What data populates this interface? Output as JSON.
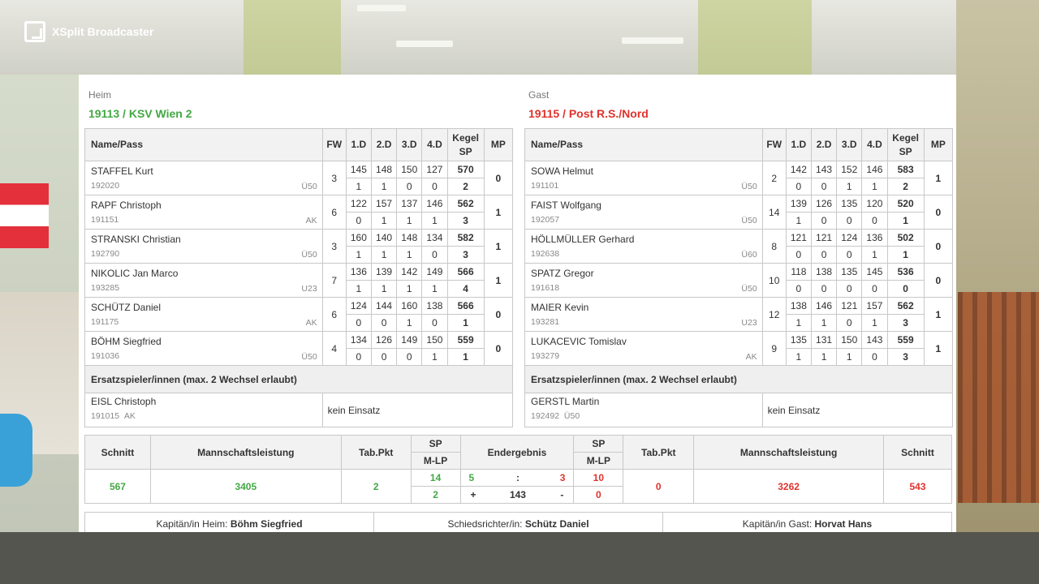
{
  "app": {
    "name": "XSplit Broadcaster"
  },
  "colors": {
    "home": "#44a844",
    "away": "#e0322c"
  },
  "headers": {
    "name": "Name/Pass",
    "fw": "FW",
    "d1": "1.D",
    "d2": "2.D",
    "d3": "3.D",
    "d4": "4.D",
    "kegel": "Kegel SP",
    "mp": "MP"
  },
  "home": {
    "role": "Heim",
    "team": "19113 / KSV Wien 2",
    "players": [
      {
        "name": "STAFFEL Kurt",
        "pass": "192020",
        "cls": "Ü50",
        "fw": "3",
        "d": [
          "145",
          "148",
          "150",
          "127"
        ],
        "dsp": [
          "1",
          "1",
          "0",
          "0"
        ],
        "kegel": "570",
        "sp": "2",
        "mp": "0"
      },
      {
        "name": "RAPF Christoph",
        "pass": "191151",
        "cls": "AK",
        "fw": "6",
        "d": [
          "122",
          "157",
          "137",
          "146"
        ],
        "dsp": [
          "0",
          "1",
          "1",
          "1"
        ],
        "kegel": "562",
        "sp": "3",
        "mp": "1"
      },
      {
        "name": "STRANSKI Christian",
        "pass": "192790",
        "cls": "Ü50",
        "fw": "3",
        "d": [
          "160",
          "140",
          "148",
          "134"
        ],
        "dsp": [
          "1",
          "1",
          "1",
          "0"
        ],
        "kegel": "582",
        "sp": "3",
        "mp": "1"
      },
      {
        "name": "NIKOLIC Jan Marco",
        "pass": "193285",
        "cls": "U23",
        "fw": "7",
        "d": [
          "136",
          "139",
          "142",
          "149"
        ],
        "dsp": [
          "1",
          "1",
          "1",
          "1"
        ],
        "kegel": "566",
        "sp": "4",
        "mp": "1"
      },
      {
        "name": "SCHÜTZ Daniel",
        "pass": "191175",
        "cls": "AK",
        "fw": "6",
        "d": [
          "124",
          "144",
          "160",
          "138"
        ],
        "dsp": [
          "0",
          "0",
          "1",
          "0"
        ],
        "kegel": "566",
        "sp": "1",
        "mp": "0"
      },
      {
        "name": "BÖHM Siegfried",
        "pass": "191036",
        "cls": "Ü50",
        "fw": "4",
        "d": [
          "134",
          "126",
          "149",
          "150"
        ],
        "dsp": [
          "0",
          "0",
          "0",
          "1"
        ],
        "kegel": "559",
        "sp": "1",
        "mp": "0"
      }
    ],
    "subs_header": "Ersatzspieler/innen (max. 2 Wechsel erlaubt)",
    "sub": {
      "name": "EISL Christoph",
      "pass": "191015",
      "cls": "AK",
      "status": "kein Einsatz"
    }
  },
  "away": {
    "role": "Gast",
    "team": "19115 / Post R.S./Nord",
    "players": [
      {
        "name": "SOWA Helmut",
        "pass": "191101",
        "cls": "Ü50",
        "fw": "2",
        "d": [
          "142",
          "143",
          "152",
          "146"
        ],
        "dsp": [
          "0",
          "0",
          "1",
          "1"
        ],
        "kegel": "583",
        "sp": "2",
        "mp": "1"
      },
      {
        "name": "FAIST Wolfgang",
        "pass": "192057",
        "cls": "Ü50",
        "fw": "14",
        "d": [
          "139",
          "126",
          "135",
          "120"
        ],
        "dsp": [
          "1",
          "0",
          "0",
          "0"
        ],
        "kegel": "520",
        "sp": "1",
        "mp": "0"
      },
      {
        "name": "HÖLLMÜLLER Gerhard",
        "pass": "192638",
        "cls": "Ü60",
        "fw": "8",
        "d": [
          "121",
          "121",
          "124",
          "136"
        ],
        "dsp": [
          "0",
          "0",
          "0",
          "1"
        ],
        "kegel": "502",
        "sp": "1",
        "mp": "0"
      },
      {
        "name": "SPATZ Gregor",
        "pass": "191618",
        "cls": "Ü50",
        "fw": "10",
        "d": [
          "118",
          "138",
          "135",
          "145"
        ],
        "dsp": [
          "0",
          "0",
          "0",
          "0"
        ],
        "kegel": "536",
        "sp": "0",
        "mp": "0"
      },
      {
        "name": "MAIER Kevin",
        "pass": "193281",
        "cls": "U23",
        "fw": "12",
        "d": [
          "138",
          "146",
          "121",
          "157"
        ],
        "dsp": [
          "1",
          "1",
          "0",
          "1"
        ],
        "kegel": "562",
        "sp": "3",
        "mp": "1"
      },
      {
        "name": "LUKACEVIC Tomislav",
        "pass": "193279",
        "cls": "AK",
        "fw": "9",
        "d": [
          "135",
          "131",
          "150",
          "143"
        ],
        "dsp": [
          "1",
          "1",
          "1",
          "0"
        ],
        "kegel": "559",
        "sp": "3",
        "mp": "1"
      }
    ],
    "subs_header": "Ersatzspieler/innen (max. 2 Wechsel erlaubt)",
    "sub": {
      "name": "GERSTL Martin",
      "pass": "192492",
      "cls": "Ü50",
      "status": "kein Einsatz"
    }
  },
  "summary": {
    "h_schnitt": "Schnitt",
    "h_mannschaft": "Mannschaftsleistung",
    "h_tabpkt": "Tab.Pkt",
    "h_sp": "SP",
    "h_mlp": "M-LP",
    "h_endergebnis": "Endergebnis",
    "home_schnitt": "567",
    "home_total": "3405",
    "home_tabpkt": "2",
    "home_sp": "14",
    "home_mlp": "2",
    "end_home": "5",
    "end_sep": ":",
    "end_away": "3",
    "plus": "+",
    "diff": "143",
    "minus": "-",
    "away_sp": "10",
    "away_mlp": "0",
    "away_tabpkt": "0",
    "away_total": "3262",
    "away_schnitt": "543"
  },
  "footer": {
    "captain_home_label": "Kapitän/in Heim:",
    "captain_home": "Böhm Siegfried",
    "referee_label": "Schiedsrichter/in:",
    "referee": "Schütz Daniel",
    "captain_away_label": "Kapitän/in Gast:",
    "captain_away": "Horvat Hans"
  }
}
